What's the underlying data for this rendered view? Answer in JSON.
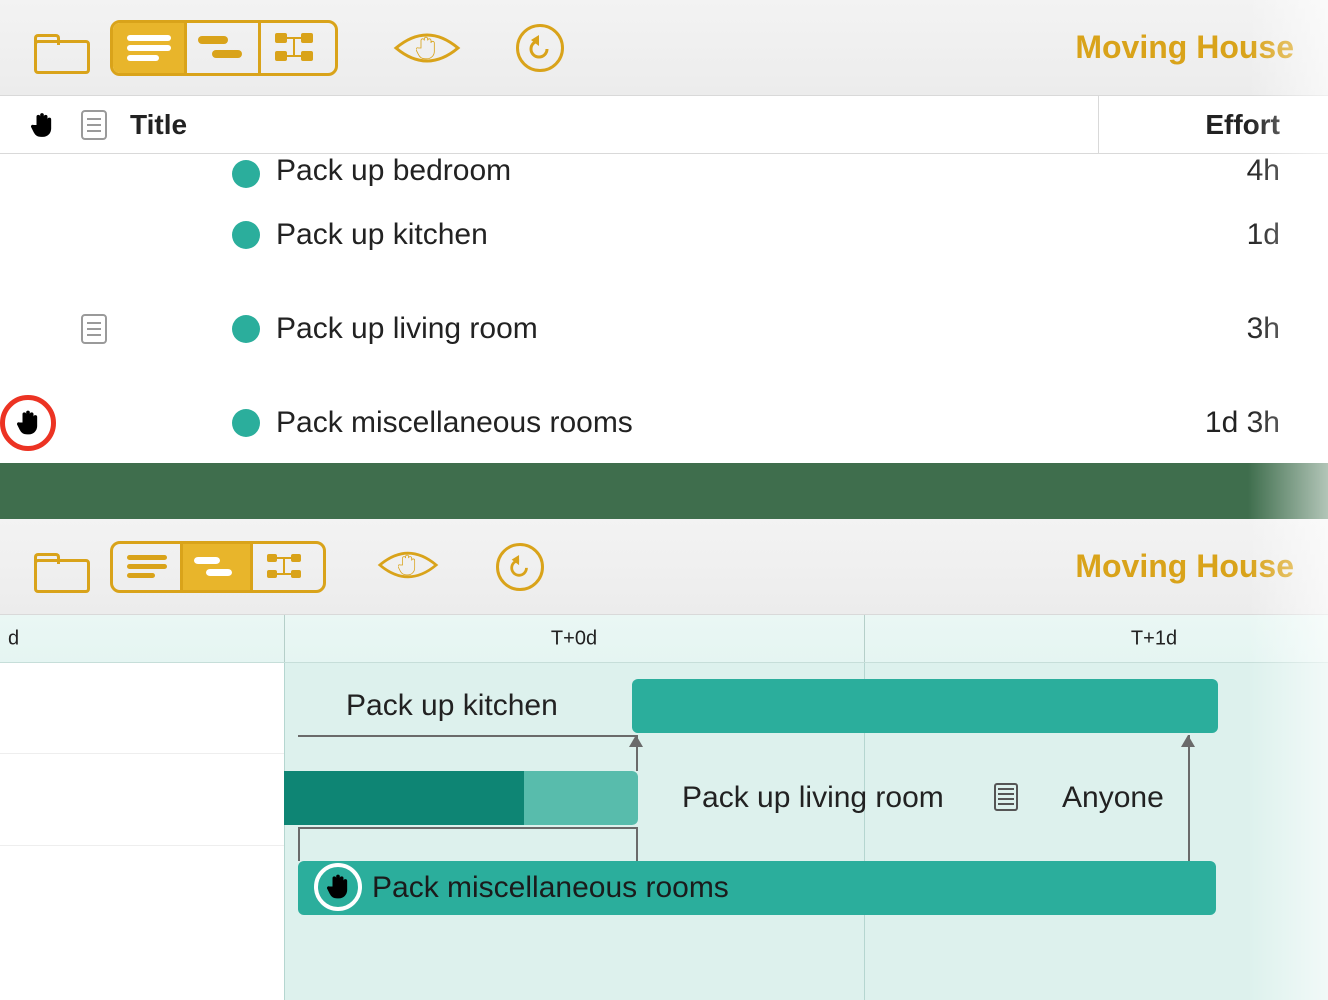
{
  "project_title": "Moving House",
  "list": {
    "columns": {
      "title": "Title",
      "effort": "Effort"
    },
    "rows": [
      {
        "title": "Pack up bedroom",
        "effort": "4h",
        "has_note": false,
        "has_hold": false,
        "clipped": true
      },
      {
        "title": "Pack up kitchen",
        "effort": "1d",
        "has_note": false,
        "has_hold": false
      },
      {
        "title": "Pack up living room",
        "effort": "3h",
        "has_note": true,
        "has_hold": false
      },
      {
        "title": "Pack miscellaneous rooms",
        "effort": "1d 3h",
        "has_note": false,
        "has_hold": true
      }
    ]
  },
  "gantt": {
    "time_labels": [
      "d",
      "T+0d",
      "T+1d"
    ],
    "tasks": {
      "kitchen_label": "Pack up kitchen",
      "living_label": "Pack up living room",
      "misc_label": "Pack miscellaneous rooms",
      "assignee": "Anyone"
    }
  }
}
